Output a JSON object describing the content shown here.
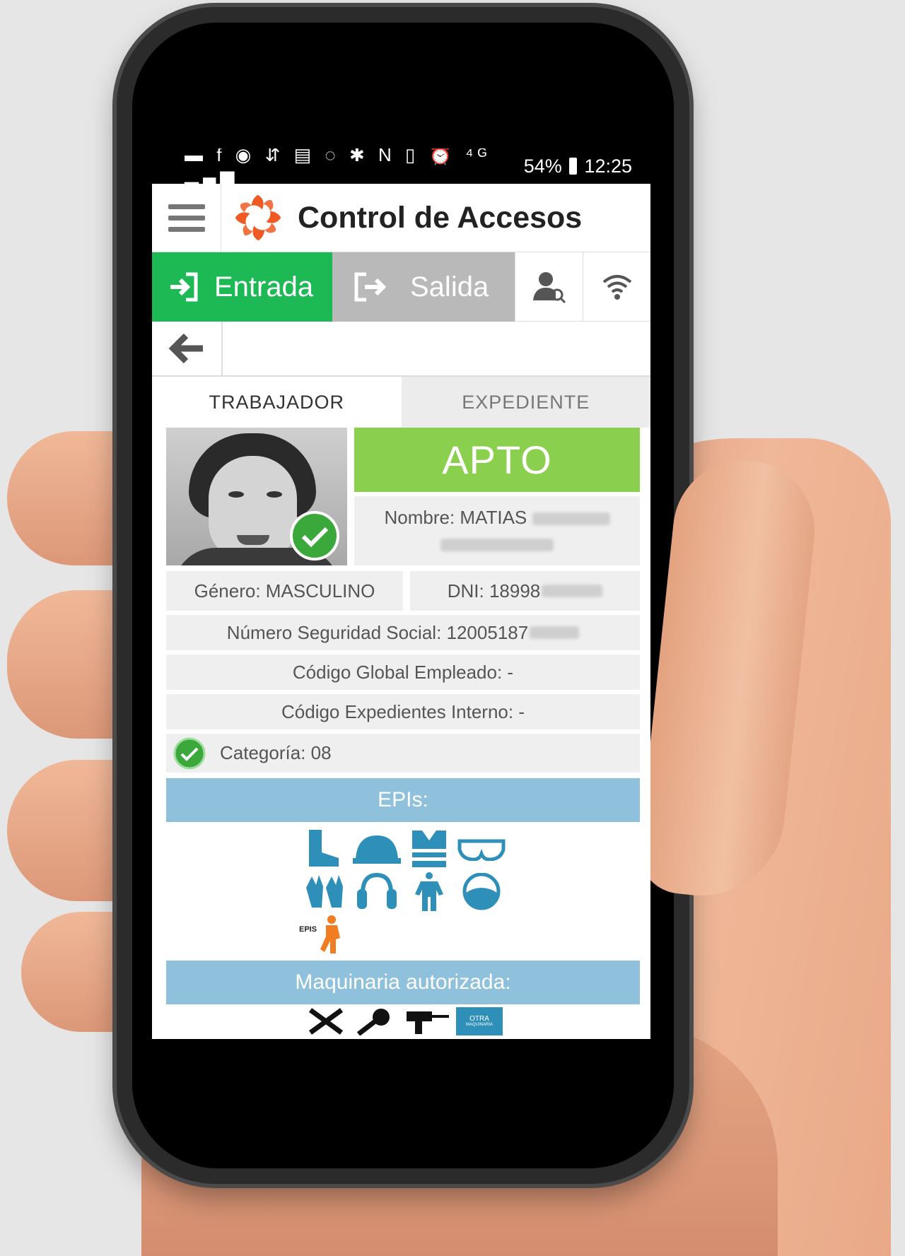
{
  "status_bar": {
    "icons": [
      "message-icon",
      "facebook-icon",
      "browser-icon",
      "usb-icon",
      "chat-icon",
      "whatsapp-icon",
      "bluetooth-icon",
      "nfc-icon",
      "vibrate-icon",
      "alarm-icon",
      "4g-icon",
      "signal-icon"
    ],
    "battery": "54%",
    "time": "12:25"
  },
  "app_bar": {
    "title": "Control de Accesos"
  },
  "actions": {
    "entrada_label": "Entrada",
    "salida_label": "Salida"
  },
  "tabs": [
    {
      "label": "TRABAJADOR",
      "active": true
    },
    {
      "label": "EXPEDIENTE",
      "active": false
    }
  ],
  "worker": {
    "status": "APTO",
    "nombre": "Nombre: MATIAS",
    "genero": "Género: MASCULINO",
    "dni": "DNI: 18998",
    "nss": "Número Seguridad Social: 12005187",
    "codigo_global": "Código Global Empleado: -",
    "codigo_expedientes": "Código Expedientes Interno: -",
    "categoria": "Categoría: 08"
  },
  "epis": {
    "header": "EPIs:",
    "icons": [
      "boots-icon",
      "helmet-icon",
      "vest-icon",
      "goggles-icon",
      "gloves-icon",
      "ear-protection-icon",
      "coverall-icon",
      "mask-icon"
    ],
    "logo_text": "EPIS"
  },
  "maquinaria": {
    "header": "Maquinaria autorizada:",
    "icons": [
      "tools-icon",
      "grinder-icon",
      "drill-icon"
    ],
    "otra_label": "OTRA",
    "otra_sub": "MAQUINARIA"
  },
  "colors": {
    "entrada": "#1db954",
    "salida": "#b9b9b9",
    "apto": "#8bcf4e",
    "section_header": "#8fc0dc",
    "epi_icon": "#2e8fb8",
    "logo_orange": "#f05a22"
  }
}
